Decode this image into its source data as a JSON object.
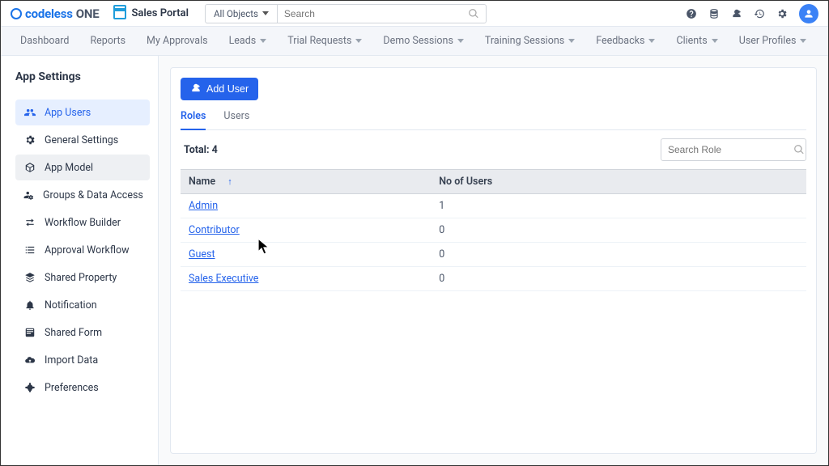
{
  "header": {
    "brand_prefix": "codeless",
    "brand_suffix": "ONE",
    "portal_name": "Sales Portal",
    "all_objects_label": "All Objects",
    "search_placeholder": "Search"
  },
  "nav": {
    "items": [
      {
        "label": "Dashboard",
        "dropdown": false
      },
      {
        "label": "Reports",
        "dropdown": false
      },
      {
        "label": "My Approvals",
        "dropdown": false
      },
      {
        "label": "Leads",
        "dropdown": true
      },
      {
        "label": "Trial Requests",
        "dropdown": true
      },
      {
        "label": "Demo Sessions",
        "dropdown": true
      },
      {
        "label": "Training Sessions",
        "dropdown": true
      },
      {
        "label": "Feedbacks",
        "dropdown": true
      },
      {
        "label": "Clients",
        "dropdown": true
      },
      {
        "label": "User Profiles",
        "dropdown": true
      }
    ]
  },
  "sidebar": {
    "title": "App Settings",
    "items": [
      {
        "label": "App Users",
        "icon": "users"
      },
      {
        "label": "General Settings",
        "icon": "gear"
      },
      {
        "label": "App Model",
        "icon": "cube"
      },
      {
        "label": "Groups & Data Access",
        "icon": "usersgear"
      },
      {
        "label": "Workflow Builder",
        "icon": "arrows"
      },
      {
        "label": "Approval Workflow",
        "icon": "checklist"
      },
      {
        "label": "Shared Property",
        "icon": "stack"
      },
      {
        "label": "Notification",
        "icon": "bell"
      },
      {
        "label": "Shared Form",
        "icon": "form"
      },
      {
        "label": "Import Data",
        "icon": "cloud"
      },
      {
        "label": "Preferences",
        "icon": "sliders"
      }
    ]
  },
  "main": {
    "add_user_label": "Add User",
    "tabs": [
      {
        "label": "Roles"
      },
      {
        "label": "Users"
      }
    ],
    "total_label": "Total: 4",
    "search_placeholder": "Search Role",
    "columns": {
      "name": "Name",
      "users": "No of Users"
    },
    "rows": [
      {
        "name": "Admin",
        "users": "1"
      },
      {
        "name": "Contributor",
        "users": "0"
      },
      {
        "name": "Guest",
        "users": "0"
      },
      {
        "name": "Sales Executive",
        "users": "0"
      }
    ]
  }
}
